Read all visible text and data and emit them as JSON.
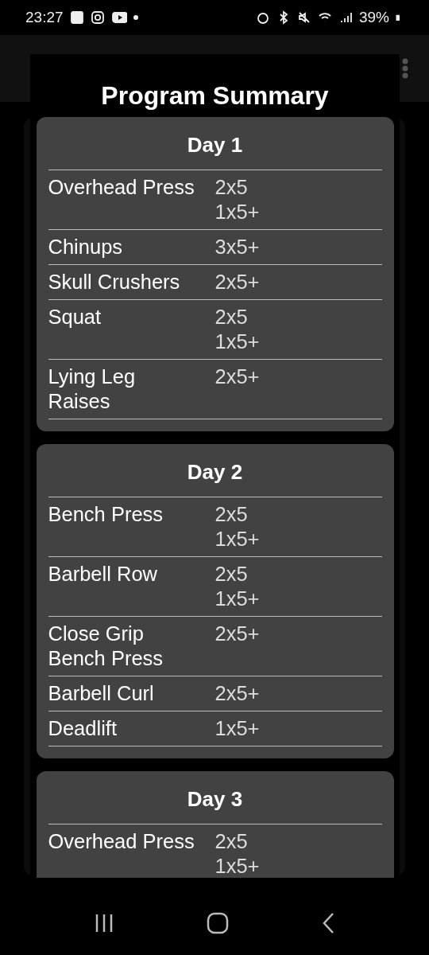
{
  "status_bar": {
    "time": "23:27",
    "battery": "39%"
  },
  "dialog": {
    "title": "Program Summary",
    "days": [
      {
        "title": "Day 1",
        "exercises": [
          {
            "name": "Overhead Press",
            "sets": [
              "2x5",
              "1x5+"
            ]
          },
          {
            "name": "Chinups",
            "sets": [
              "3x5+"
            ]
          },
          {
            "name": "Skull Crushers",
            "sets": [
              "2x5+"
            ]
          },
          {
            "name": "Squat",
            "sets": [
              "2x5",
              "1x5+"
            ]
          },
          {
            "name": "Lying Leg Raises",
            "sets": [
              "2x5+"
            ]
          }
        ]
      },
      {
        "title": "Day 2",
        "exercises": [
          {
            "name": "Bench Press",
            "sets": [
              "2x5",
              "1x5+"
            ]
          },
          {
            "name": "Barbell Row",
            "sets": [
              "2x5",
              "1x5+"
            ]
          },
          {
            "name": "Close Grip Bench Press",
            "sets": [
              "2x5+"
            ]
          },
          {
            "name": "Barbell Curl",
            "sets": [
              "2x5+"
            ]
          },
          {
            "name": "Deadlift",
            "sets": [
              "1x5+"
            ]
          }
        ]
      },
      {
        "title": "Day 3",
        "exercises": [
          {
            "name": "Overhead Press",
            "sets": [
              "2x5",
              "1x5+"
            ]
          }
        ]
      }
    ]
  }
}
